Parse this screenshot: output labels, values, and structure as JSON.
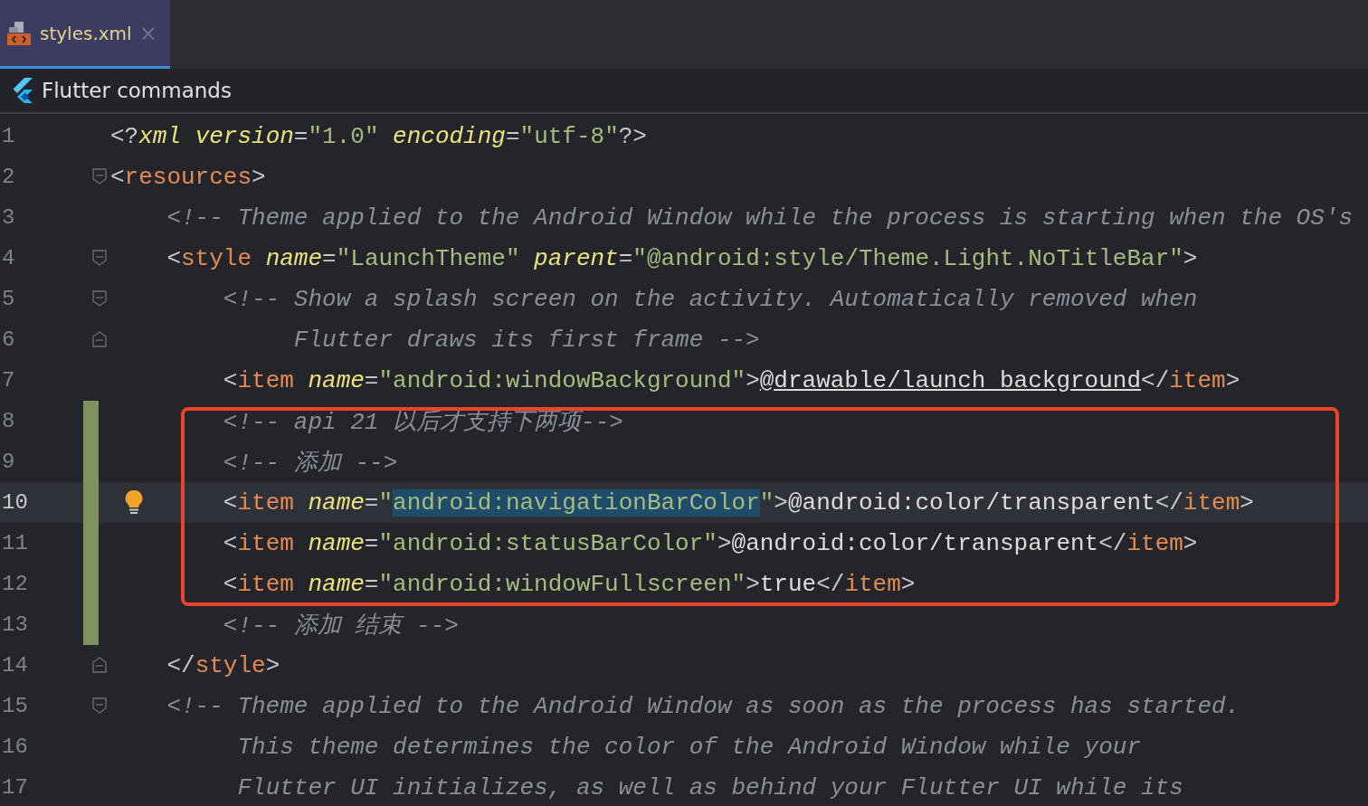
{
  "tabs": [
    {
      "label": "styles.xml",
      "selected": true,
      "close": "×"
    }
  ],
  "toolbar": {
    "label": "Flutter commands"
  },
  "editor": {
    "lines": [
      {
        "number": "1",
        "current": false,
        "changed": false,
        "boxed": false,
        "fold_start": false,
        "fold_end": false,
        "bulb": false,
        "tokens": [
          {
            "kind": "punct",
            "text": "<?"
          },
          {
            "kind": "attr",
            "text": "xml "
          },
          {
            "kind": "attr",
            "text": "version"
          },
          {
            "kind": "punct",
            "text": "="
          },
          {
            "kind": "str",
            "text": "\"1.0\" "
          },
          {
            "kind": "attr",
            "text": "encoding"
          },
          {
            "kind": "punct",
            "text": "="
          },
          {
            "kind": "str",
            "text": "\"utf-8\""
          },
          {
            "kind": "punct",
            "text": "?>"
          }
        ]
      },
      {
        "number": "2",
        "current": false,
        "changed": false,
        "boxed": false,
        "fold_start": true,
        "fold_end": false,
        "bulb": false,
        "tokens": [
          {
            "kind": "punct",
            "text": "<"
          },
          {
            "kind": "tag",
            "text": "resources"
          },
          {
            "kind": "punct",
            "text": ">"
          }
        ],
        "children": [
          {
            "number": "3",
            "current": false,
            "changed": false,
            "boxed": false,
            "fold_start": false,
            "fold_end": false,
            "bulb": false,
            "tokens": [
              {
                "kind": "comment",
                "text": "<!-- Theme applied to the Android Window while the process is starting when the OS's"
              }
            ]
          },
          {
            "number": "4",
            "current": false,
            "changed": false,
            "boxed": false,
            "fold_start": true,
            "fold_end": false,
            "bulb": false,
            "tokens": [
              {
                "kind": "punct",
                "text": "<"
              },
              {
                "kind": "tag",
                "text": "style "
              },
              {
                "kind": "attr",
                "text": "name"
              },
              {
                "kind": "punct",
                "text": "="
              },
              {
                "kind": "str",
                "text": "\"LaunchTheme\" "
              },
              {
                "kind": "attr",
                "text": "parent"
              },
              {
                "kind": "punct",
                "text": "="
              },
              {
                "kind": "str",
                "text": "\"@android:style/Theme.Light.NoTitleBar\""
              },
              {
                "kind": "punct",
                "text": ">"
              }
            ],
            "children": [
              {
                "number": "5",
                "current": false,
                "changed": false,
                "boxed": false,
                "fold_start": true,
                "fold_end": false,
                "bulb": false,
                "tokens": [
                  {
                    "kind": "comment",
                    "text": "<!-- Show a splash screen on the activity. Automatically removed when"
                  }
                ],
                "children": [
                  {
                    "number": "6",
                    "current": false,
                    "changed": false,
                    "boxed": false,
                    "fold_start": false,
                    "fold_end": true,
                    "bulb": false,
                    "tokens": [
                      {
                        "kind": "comment",
                        "text": "Flutter draws its first frame -->"
                      }
                    ]
                  }
                ]
              },
              {
                "number": "7",
                "current": false,
                "changed": false,
                "boxed": false,
                "fold_start": false,
                "fold_end": false,
                "bulb": false,
                "tokens": [
                  {
                    "kind": "punct",
                    "text": "<"
                  },
                  {
                    "kind": "tag",
                    "text": "item "
                  },
                  {
                    "kind": "attr",
                    "text": "name"
                  },
                  {
                    "kind": "punct",
                    "text": "="
                  },
                  {
                    "kind": "str",
                    "text": "\"android:windowBackground\""
                  },
                  {
                    "kind": "punct",
                    "text": ">"
                  },
                  {
                    "kind": "link",
                    "text": "@drawable/launch_background"
                  },
                  {
                    "kind": "punct",
                    "text": "</"
                  },
                  {
                    "kind": "tag",
                    "text": "item"
                  },
                  {
                    "kind": "punct",
                    "text": ">"
                  }
                ]
              },
              {
                "number": "8",
                "current": false,
                "changed": true,
                "boxed": true,
                "fold_start": false,
                "fold_end": false,
                "bulb": false,
                "tokens": [
                  {
                    "kind": "comment",
                    "text": "<!-- api 21 以后才支持下两项-->"
                  }
                ]
              },
              {
                "number": "9",
                "current": false,
                "changed": true,
                "boxed": true,
                "fold_start": false,
                "fold_end": false,
                "bulb": false,
                "tokens": [
                  {
                    "kind": "comment",
                    "text": "<!-- 添加 -->"
                  }
                ]
              },
              {
                "number": "10",
                "current": true,
                "changed": true,
                "boxed": true,
                "fold_start": false,
                "fold_end": false,
                "bulb": true,
                "tokens": [
                  {
                    "kind": "punct",
                    "text": "<"
                  },
                  {
                    "kind": "tag",
                    "text": "item "
                  },
                  {
                    "kind": "attr",
                    "text": "name"
                  },
                  {
                    "kind": "punct",
                    "text": "="
                  },
                  {
                    "kind": "str",
                    "text": "\""
                  },
                  {
                    "kind": "str_selected",
                    "text": "android:navigationBarColor"
                  },
                  {
                    "kind": "str",
                    "text": "\""
                  },
                  {
                    "kind": "punct",
                    "text": ">"
                  },
                  {
                    "kind": "text",
                    "text": "@android:color/transparent"
                  },
                  {
                    "kind": "punct",
                    "text": "</"
                  },
                  {
                    "kind": "tag",
                    "text": "item"
                  },
                  {
                    "kind": "punct",
                    "text": ">"
                  }
                ]
              },
              {
                "number": "11",
                "current": false,
                "changed": true,
                "boxed": true,
                "fold_start": false,
                "fold_end": false,
                "bulb": false,
                "tokens": [
                  {
                    "kind": "punct",
                    "text": "<"
                  },
                  {
                    "kind": "tag",
                    "text": "item "
                  },
                  {
                    "kind": "attr",
                    "text": "name"
                  },
                  {
                    "kind": "punct",
                    "text": "="
                  },
                  {
                    "kind": "str",
                    "text": "\"android:statusBarColor\""
                  },
                  {
                    "kind": "punct",
                    "text": ">"
                  },
                  {
                    "kind": "text",
                    "text": "@android:color/transparent"
                  },
                  {
                    "kind": "punct",
                    "text": "</"
                  },
                  {
                    "kind": "tag",
                    "text": "item"
                  },
                  {
                    "kind": "punct",
                    "text": ">"
                  }
                ]
              },
              {
                "number": "12",
                "current": false,
                "changed": true,
                "boxed": true,
                "fold_start": false,
                "fold_end": false,
                "bulb": false,
                "tokens": [
                  {
                    "kind": "punct",
                    "text": "<"
                  },
                  {
                    "kind": "tag",
                    "text": "item "
                  },
                  {
                    "kind": "attr",
                    "text": "name"
                  },
                  {
                    "kind": "punct",
                    "text": "="
                  },
                  {
                    "kind": "str",
                    "text": "\"android:windowFullscreen\""
                  },
                  {
                    "kind": "punct",
                    "text": ">"
                  },
                  {
                    "kind": "text",
                    "text": "true"
                  },
                  {
                    "kind": "punct",
                    "text": "</"
                  },
                  {
                    "kind": "tag",
                    "text": "item"
                  },
                  {
                    "kind": "punct",
                    "text": ">"
                  }
                ]
              },
              {
                "number": "13",
                "current": false,
                "changed": true,
                "boxed": false,
                "fold_start": false,
                "fold_end": false,
                "bulb": false,
                "tokens": [
                  {
                    "kind": "comment",
                    "text": "<!-- 添加 结束 -->"
                  }
                ]
              }
            ]
          },
          {
            "number": "14",
            "current": false,
            "changed": false,
            "boxed": false,
            "fold_start": false,
            "fold_end": true,
            "bulb": false,
            "tokens": [
              {
                "kind": "punct",
                "text": "</"
              },
              {
                "kind": "tag",
                "text": "style"
              },
              {
                "kind": "punct",
                "text": ">"
              }
            ]
          },
          {
            "number": "15",
            "current": false,
            "changed": false,
            "boxed": false,
            "fold_start": true,
            "fold_end": false,
            "bulb": false,
            "tokens": [
              {
                "kind": "comment",
                "text": "<!-- Theme applied to the Android Window as soon as the process has started."
              }
            ],
            "children": [
              {
                "number": "16",
                "current": false,
                "changed": false,
                "boxed": false,
                "fold_start": false,
                "fold_end": false,
                "bulb": false,
                "tokens": [
                  {
                    "kind": "comment",
                    "text": "This theme determines the color of the Android Window while your"
                  }
                ]
              },
              {
                "number": "17",
                "current": false,
                "changed": false,
                "boxed": false,
                "fold_start": false,
                "fold_end": false,
                "bulb": false,
                "tokens": [
                  {
                    "kind": "comment",
                    "text": "Flutter UI initializes, as well as behind your Flutter UI while its"
                  }
                ]
              }
            ]
          }
        ]
      }
    ]
  }
}
